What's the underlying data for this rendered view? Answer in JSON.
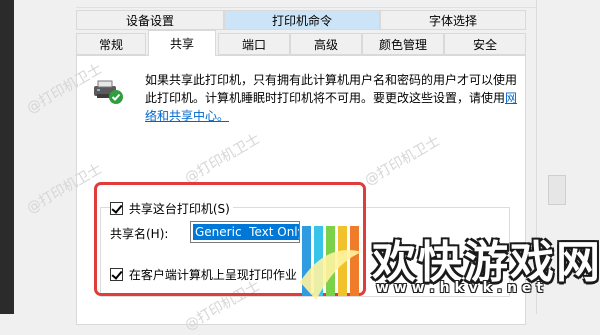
{
  "tabs_row1": [
    {
      "label": "设备设置"
    },
    {
      "label": "打印机命令"
    },
    {
      "label": "字体选择"
    }
  ],
  "tabs_row2": [
    {
      "label": "常规"
    },
    {
      "label": "共享"
    },
    {
      "label": "端口"
    },
    {
      "label": "高级"
    },
    {
      "label": "颜色管理"
    },
    {
      "label": "安全"
    }
  ],
  "info": {
    "text": "如果共享此打印机，只有拥有此计算机用户名和密码的用户才可以使用此打印机。计算机睡眠时打印机将不可用。要更改这些设置，请使用",
    "link": "网络和共享中心。"
  },
  "share": {
    "checkbox_label": "共享这台打印机(S)",
    "checked": true,
    "name_label": "共享名(H):",
    "name_value": "Generic  Text Only",
    "render_label": "在客户端计算机上呈现打印作业",
    "render_checked": true
  },
  "watermarks": [
    "@打印机卫士",
    "@打印机卫士",
    "@打印机卫士",
    "@打印机卫士",
    "@打印机卫士"
  ],
  "overlay": {
    "brand": "欢快游戏网",
    "url": "w w w . h k v k . n e t"
  },
  "colors": {
    "highlight_tab": "#cce4f7",
    "red_box": "#e03c3c",
    "link": "#0066cc",
    "select_bg": "#0078d7"
  }
}
